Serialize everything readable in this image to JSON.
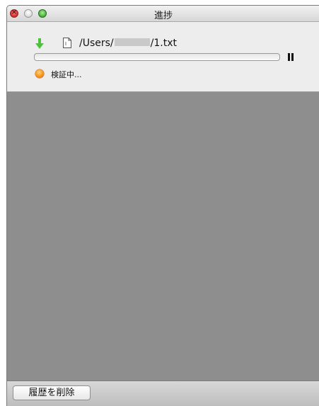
{
  "window": {
    "title": "進捗"
  },
  "download_item": {
    "path_prefix": "/Users/",
    "path_suffix": "/1.txt",
    "progress": 0,
    "status_text": "検証中...",
    "icons": {
      "download": "download-arrow-icon",
      "file": "text-file-icon",
      "pause": "pause-icon",
      "status": "orange-status-dot-icon"
    }
  },
  "bottombar": {
    "clear_history_label": "履歴を削除"
  },
  "colors": {
    "download_arrow": "#4cc43a",
    "status_dot": "#f7941d",
    "list_background": "#8e8e8e"
  }
}
